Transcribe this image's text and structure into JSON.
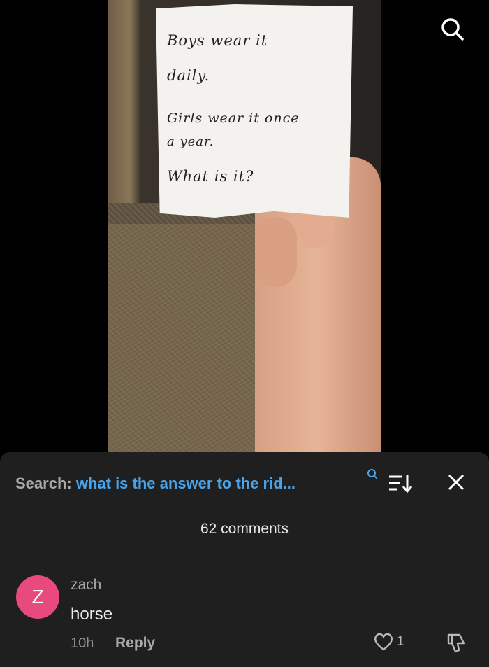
{
  "note": {
    "lines": [
      "Boys wear it",
      "daily.",
      "Girls wear it once",
      "a year.",
      "What is it?"
    ]
  },
  "icons": {
    "top_search": "search-icon",
    "inline_search": "search-icon",
    "sort": "sort-icon",
    "close": "close-icon",
    "like": "heart-icon",
    "dislike": "thumbs-down-icon"
  },
  "comments_panel": {
    "search_prefix": "Search:",
    "search_query": "what is the answer to the rid...",
    "count_label": "62 comments"
  },
  "comment": {
    "avatar_letter": "Z",
    "avatar_color": "#e94a7d",
    "username": "zach",
    "text": "horse",
    "time": "10h",
    "reply_label": "Reply",
    "likes": "1"
  },
  "colors": {
    "accent": "#4aa3e8",
    "panel_bg": "#1f1f1f"
  }
}
